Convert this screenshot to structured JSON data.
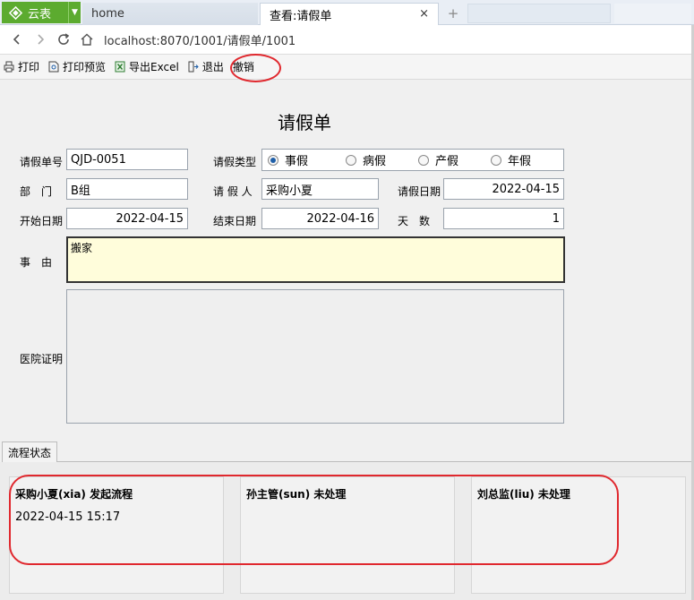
{
  "browser": {
    "logo_label": "云表",
    "tabs": [
      {
        "label": "home"
      },
      {
        "label": "查看:请假单"
      }
    ],
    "close_glyph": "×",
    "new_tab_glyph": "+",
    "url": "localhost:8070/1001/请假单/1001"
  },
  "toolbar": {
    "items": [
      {
        "label": "打印",
        "icon": "print-icon"
      },
      {
        "label": "打印预览",
        "icon": "print-preview-icon"
      },
      {
        "label": "导出Excel",
        "icon": "excel-icon"
      },
      {
        "label": "退出",
        "icon": "exit-icon"
      },
      {
        "label": "撤销",
        "icon": ""
      }
    ]
  },
  "form": {
    "title": "请假单",
    "labels": {
      "number": "请假单号",
      "type": "请假类型",
      "dept": "部　门",
      "person": "请 假 人",
      "date": "请假日期",
      "start": "开始日期",
      "end": "结束日期",
      "days": "天　数",
      "reason": "事　由",
      "cert": "医院证明"
    },
    "values": {
      "number": "QJD-0051",
      "dept": "B组",
      "person": "采购小夏",
      "date": "2022-04-15",
      "start": "2022-04-15",
      "end": "2022-04-16",
      "days": "1",
      "reason": "搬家"
    },
    "leave_types": [
      "事假",
      "病假",
      "产假",
      "年假"
    ],
    "selected_type": "事假"
  },
  "flow": {
    "tab_label": "流程状态",
    "steps": [
      {
        "title": "采购小夏(xia)  发起流程",
        "time": "2022-04-15 15:17"
      },
      {
        "title": "孙主管(sun) 未处理",
        "time": ""
      },
      {
        "title": "刘总监(liu) 未处理",
        "time": ""
      }
    ]
  },
  "colors": {
    "accent_green": "#5cab2f",
    "annotation_red": "#e0282e",
    "reason_bg": "#fffddb"
  }
}
